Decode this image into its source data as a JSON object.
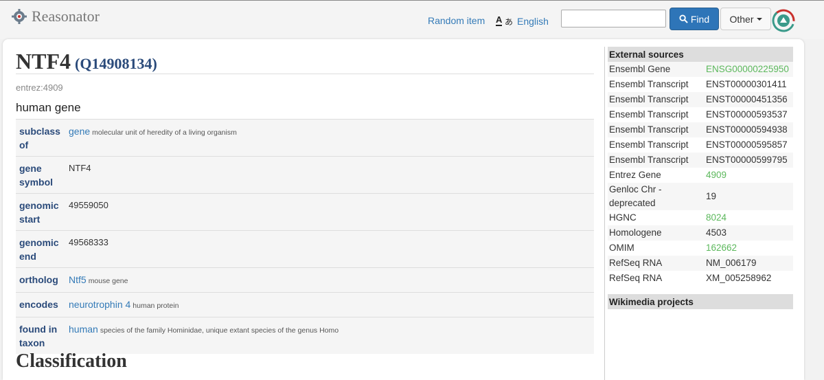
{
  "brand": {
    "name": "Reasonator"
  },
  "nav": {
    "random": "Random item",
    "language": "English"
  },
  "search": {
    "value": "",
    "find_label": "Find",
    "other_label": "Other"
  },
  "item": {
    "label": "NTF4",
    "qid": "(Q14908134)",
    "alias": "entrez:4909",
    "description": "human gene"
  },
  "claims": [
    {
      "prop": "subclass of",
      "value": "gene",
      "value_link": true,
      "note": "molecular unit of heredity of a living organism"
    },
    {
      "prop": "gene symbol",
      "value": "NTF4",
      "value_link": false,
      "note": ""
    },
    {
      "prop": "genomic start",
      "value": "49559050",
      "value_link": false,
      "note": ""
    },
    {
      "prop": "genomic end",
      "value": "49568333",
      "value_link": false,
      "note": ""
    },
    {
      "prop": "ortholog",
      "value": "Ntf5",
      "value_link": true,
      "note": "mouse gene"
    },
    {
      "prop": "encodes",
      "value": "neurotrophin 4",
      "value_link": true,
      "note": "human protein"
    },
    {
      "prop": "found in taxon",
      "value": "human",
      "value_link": true,
      "note": "species of the family Hominidae, unique extant species of the genus Homo"
    }
  ],
  "section": {
    "classification": "Classification"
  },
  "external": {
    "heading": "External sources",
    "rows": [
      {
        "k": "Ensembl Gene",
        "v": "ENSG00000225950",
        "link": true
      },
      {
        "k": "Ensembl Transcript",
        "v": "ENST00000301411",
        "link": false
      },
      {
        "k": "Ensembl Transcript",
        "v": "ENST00000451356",
        "link": false
      },
      {
        "k": "Ensembl Transcript",
        "v": "ENST00000593537",
        "link": false
      },
      {
        "k": "Ensembl Transcript",
        "v": "ENST00000594938",
        "link": false
      },
      {
        "k": "Ensembl Transcript",
        "v": "ENST00000595857",
        "link": false
      },
      {
        "k": "Ensembl Transcript",
        "v": "ENST00000599795",
        "link": false
      },
      {
        "k": "Entrez Gene",
        "v": "4909",
        "link": true
      },
      {
        "k": "Genloc Chr - deprecated",
        "v": "19",
        "link": false
      },
      {
        "k": "HGNC",
        "v": "8024",
        "link": true
      },
      {
        "k": "Homologene",
        "v": "4503",
        "link": false
      },
      {
        "k": "OMIM",
        "v": "162662",
        "link": true
      },
      {
        "k": "RefSeq RNA",
        "v": "NM_006179",
        "link": false
      },
      {
        "k": "RefSeq RNA",
        "v": "XM_005258962",
        "link": false
      }
    ],
    "wikimedia_heading": "Wikimedia projects"
  },
  "colors": {
    "link": "#337ab7",
    "external_link": "#5cb85c",
    "find_button": "#2e75b8"
  }
}
